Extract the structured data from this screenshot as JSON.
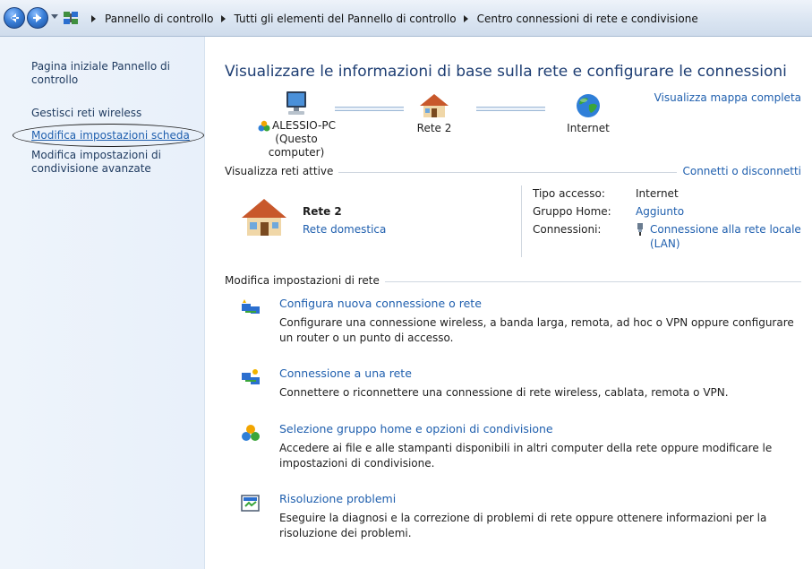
{
  "breadcrumb": {
    "items": [
      "Pannello di controllo",
      "Tutti gli elementi del Pannello di controllo",
      "Centro connessioni di rete e condivisione"
    ]
  },
  "sidebar": {
    "home": "Pagina iniziale Pannello di controllo",
    "wireless": "Gestisci reti wireless",
    "adapter": "Modifica impostazioni scheda",
    "advanced": "Modifica impostazioni di condivisione avanzate"
  },
  "main": {
    "title": "Visualizzare le informazioni di base sulla rete e configurare le connessioni",
    "view_map": "Visualizza mappa completa",
    "map": {
      "computer_name": "ALESSIO-PC",
      "computer_sub": "(Questo computer)",
      "network": "Rete 2",
      "internet": "Internet"
    },
    "active": {
      "header": "Visualizza reti attive",
      "connect": "Connetti o disconnetti",
      "name": "Rete 2",
      "type": "Rete domestica",
      "access_label": "Tipo accesso:",
      "access_value": "Internet",
      "homegroup_label": "Gruppo Home:",
      "homegroup_value": "Aggiunto",
      "connections_label": "Connessioni:",
      "connections_value": "Connessione alla rete locale (LAN)"
    },
    "change": {
      "header": "Modifica impostazioni di rete",
      "tasks": [
        {
          "link": "Configura nuova connessione o rete",
          "desc": "Configurare una connessione wireless, a banda larga, remota, ad hoc o VPN oppure configurare un router o un punto di accesso.",
          "icon": "new-connection-icon"
        },
        {
          "link": "Connessione a una rete",
          "desc": "Connettere o riconnettere una connessione di rete wireless, cablata, remota o VPN.",
          "icon": "connect-network-icon"
        },
        {
          "link": "Selezione gruppo home e opzioni di condivisione",
          "desc": "Accedere ai file e alle stampanti disponibili in altri computer della rete oppure modificare le impostazioni di condivisione.",
          "icon": "homegroup-icon"
        },
        {
          "link": "Risoluzione problemi",
          "desc": "Eseguire la diagnosi e la correzione di problemi di rete oppure ottenere informazioni per la risoluzione dei problemi.",
          "icon": "troubleshoot-icon"
        }
      ]
    }
  },
  "colors": {
    "link": "#1f5fae",
    "title": "#1e3e73",
    "sidebar_bg": "#eef4fb"
  }
}
